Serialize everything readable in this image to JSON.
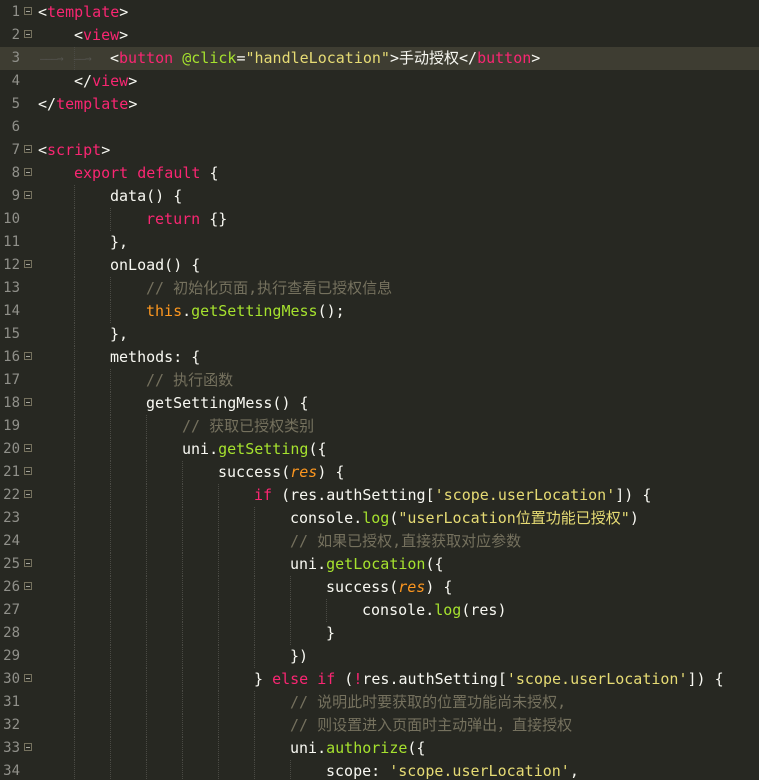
{
  "editor": {
    "theme_colors": {
      "background": "#272822",
      "tag": "#f92672",
      "keyword": "#f92672",
      "string": "#e6db74",
      "function": "#a6e22e",
      "comment": "#75715e",
      "parameter": "#fd971f",
      "text": "#f8f8f2",
      "line_number": "#90908a"
    },
    "active_line": 3,
    "lines": [
      {
        "n": "1",
        "fold": true,
        "indent": 0,
        "tokens": [
          [
            "pun",
            "<"
          ],
          [
            "tag",
            "template"
          ],
          [
            "pun",
            ">"
          ]
        ]
      },
      {
        "n": "2",
        "fold": true,
        "indent": 1,
        "tokens": [
          [
            "pun",
            "<"
          ],
          [
            "tag",
            "view"
          ],
          [
            "pun",
            ">"
          ]
        ]
      },
      {
        "n": "3",
        "fold": false,
        "indent": 2,
        "arrows": true,
        "tokens": [
          [
            "pun",
            "<"
          ],
          [
            "tag",
            "button"
          ],
          [
            "txt",
            " "
          ],
          [
            "attr",
            "@click"
          ],
          [
            "pun",
            "="
          ],
          [
            "str",
            "\"handleLocation\""
          ],
          [
            "pun",
            ">"
          ],
          [
            "txt",
            "手动授权"
          ],
          [
            "pun",
            "</"
          ],
          [
            "tag",
            "button"
          ],
          [
            "pun",
            ">"
          ]
        ]
      },
      {
        "n": "4",
        "fold": false,
        "indent": 1,
        "tokens": [
          [
            "pun",
            "</"
          ],
          [
            "tag",
            "view"
          ],
          [
            "pun",
            ">"
          ]
        ]
      },
      {
        "n": "5",
        "fold": false,
        "indent": 0,
        "tokens": [
          [
            "pun",
            "</"
          ],
          [
            "tag",
            "template"
          ],
          [
            "pun",
            ">"
          ]
        ]
      },
      {
        "n": "6",
        "fold": false,
        "indent": 0,
        "tokens": []
      },
      {
        "n": "7",
        "fold": true,
        "indent": 0,
        "tokens": [
          [
            "pun",
            "<"
          ],
          [
            "tag",
            "script"
          ],
          [
            "pun",
            ">"
          ]
        ]
      },
      {
        "n": "8",
        "fold": true,
        "indent": 1,
        "tokens": [
          [
            "kw",
            "export"
          ],
          [
            "txt",
            " "
          ],
          [
            "kw",
            "default"
          ],
          [
            "txt",
            " {"
          ]
        ]
      },
      {
        "n": "9",
        "fold": true,
        "indent": 2,
        "tokens": [
          [
            "txt",
            "data() {"
          ]
        ]
      },
      {
        "n": "10",
        "fold": false,
        "indent": 3,
        "tokens": [
          [
            "kw",
            "return"
          ],
          [
            "txt",
            " {}"
          ]
        ]
      },
      {
        "n": "11",
        "fold": false,
        "indent": 2,
        "tokens": [
          [
            "txt",
            "},"
          ]
        ]
      },
      {
        "n": "12",
        "fold": true,
        "indent": 2,
        "tokens": [
          [
            "txt",
            "onLoad() {"
          ]
        ]
      },
      {
        "n": "13",
        "fold": false,
        "indent": 3,
        "tokens": [
          [
            "cmt",
            "// 初始化页面,执行查看已授权信息"
          ]
        ]
      },
      {
        "n": "14",
        "fold": false,
        "indent": 3,
        "tokens": [
          [
            "this",
            "this"
          ],
          [
            "txt",
            "."
          ],
          [
            "fn",
            "getSettingMess"
          ],
          [
            "txt",
            "();"
          ]
        ]
      },
      {
        "n": "15",
        "fold": false,
        "indent": 2,
        "tokens": [
          [
            "txt",
            "},"
          ]
        ]
      },
      {
        "n": "16",
        "fold": true,
        "indent": 2,
        "tokens": [
          [
            "txt",
            "methods: {"
          ]
        ]
      },
      {
        "n": "17",
        "fold": false,
        "indent": 3,
        "tokens": [
          [
            "cmt",
            "// 执行函数"
          ]
        ]
      },
      {
        "n": "18",
        "fold": true,
        "indent": 3,
        "tokens": [
          [
            "txt",
            "getSettingMess() {"
          ]
        ]
      },
      {
        "n": "19",
        "fold": false,
        "indent": 4,
        "tokens": [
          [
            "cmt",
            "// 获取已授权类别"
          ]
        ]
      },
      {
        "n": "20",
        "fold": true,
        "indent": 4,
        "tokens": [
          [
            "txt",
            "uni."
          ],
          [
            "fn",
            "getSetting"
          ],
          [
            "txt",
            "({"
          ]
        ]
      },
      {
        "n": "21",
        "fold": true,
        "indent": 5,
        "tokens": [
          [
            "txt",
            "success("
          ],
          [
            "par",
            "res"
          ],
          [
            "txt",
            ") {"
          ]
        ]
      },
      {
        "n": "22",
        "fold": true,
        "indent": 6,
        "tokens": [
          [
            "kw",
            "if"
          ],
          [
            "txt",
            " (res.authSetting["
          ],
          [
            "str",
            "'scope.userLocation'"
          ],
          [
            "txt",
            "]) {"
          ]
        ]
      },
      {
        "n": "23",
        "fold": false,
        "indent": 7,
        "tokens": [
          [
            "txt",
            "console."
          ],
          [
            "fn",
            "log"
          ],
          [
            "txt",
            "("
          ],
          [
            "str",
            "\"userLocation位置功能已授权\""
          ],
          [
            "txt",
            ")"
          ]
        ]
      },
      {
        "n": "24",
        "fold": false,
        "indent": 7,
        "tokens": [
          [
            "cmt",
            "// 如果已授权,直接获取对应参数"
          ]
        ]
      },
      {
        "n": "25",
        "fold": true,
        "indent": 7,
        "tokens": [
          [
            "txt",
            "uni."
          ],
          [
            "fn",
            "getLocation"
          ],
          [
            "txt",
            "({"
          ]
        ]
      },
      {
        "n": "26",
        "fold": true,
        "indent": 8,
        "tokens": [
          [
            "txt",
            "success("
          ],
          [
            "par",
            "res"
          ],
          [
            "txt",
            ") {"
          ]
        ]
      },
      {
        "n": "27",
        "fold": false,
        "indent": 9,
        "tokens": [
          [
            "txt",
            "console."
          ],
          [
            "fn",
            "log"
          ],
          [
            "txt",
            "(res)"
          ]
        ]
      },
      {
        "n": "28",
        "fold": false,
        "indent": 8,
        "tokens": [
          [
            "txt",
            "}"
          ]
        ]
      },
      {
        "n": "29",
        "fold": false,
        "indent": 7,
        "tokens": [
          [
            "txt",
            "})"
          ]
        ]
      },
      {
        "n": "30",
        "fold": true,
        "indent": 6,
        "tokens": [
          [
            "txt",
            "} "
          ],
          [
            "kw",
            "else"
          ],
          [
            "txt",
            " "
          ],
          [
            "kw",
            "if"
          ],
          [
            "txt",
            " ("
          ],
          [
            "kw",
            "!"
          ],
          [
            "txt",
            "res.authSetting["
          ],
          [
            "str",
            "'scope.userLocation'"
          ],
          [
            "txt",
            "]) {"
          ]
        ]
      },
      {
        "n": "31",
        "fold": false,
        "indent": 7,
        "tokens": [
          [
            "cmt",
            "// 说明此时要获取的位置功能尚未授权,"
          ]
        ]
      },
      {
        "n": "32",
        "fold": false,
        "indent": 7,
        "tokens": [
          [
            "cmt",
            "// 则设置进入页面时主动弹出，直接授权"
          ]
        ]
      },
      {
        "n": "33",
        "fold": true,
        "indent": 7,
        "tokens": [
          [
            "txt",
            "uni."
          ],
          [
            "fn",
            "authorize"
          ],
          [
            "txt",
            "({"
          ]
        ]
      },
      {
        "n": "34",
        "fold": false,
        "indent": 8,
        "tokens": [
          [
            "txt",
            "scope: "
          ],
          [
            "str",
            "'scope.userLocation'"
          ],
          [
            "txt",
            ","
          ]
        ]
      }
    ]
  }
}
